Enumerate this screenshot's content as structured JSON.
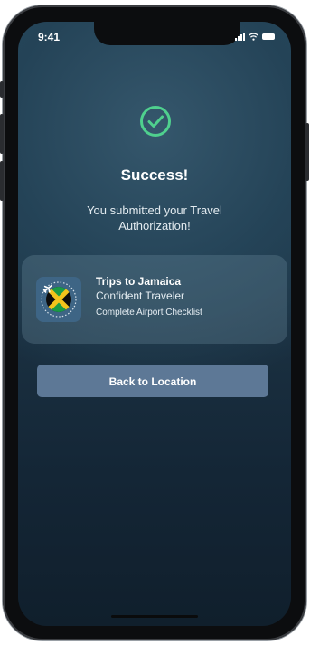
{
  "status": {
    "time": "9:41"
  },
  "success": {
    "icon": "check-circle-icon",
    "title": "Success!",
    "message": "You submitted your Travel Authorization!"
  },
  "trip_card": {
    "icon": "jamaica-flag-icon",
    "title": "Trips to Jamaica",
    "subtitle": "Confident Traveler",
    "action": "Complete Airport Checklist"
  },
  "actions": {
    "back_label": "Back to Location"
  },
  "colors": {
    "accent": "#4fd08e",
    "button": "#5d7896"
  }
}
